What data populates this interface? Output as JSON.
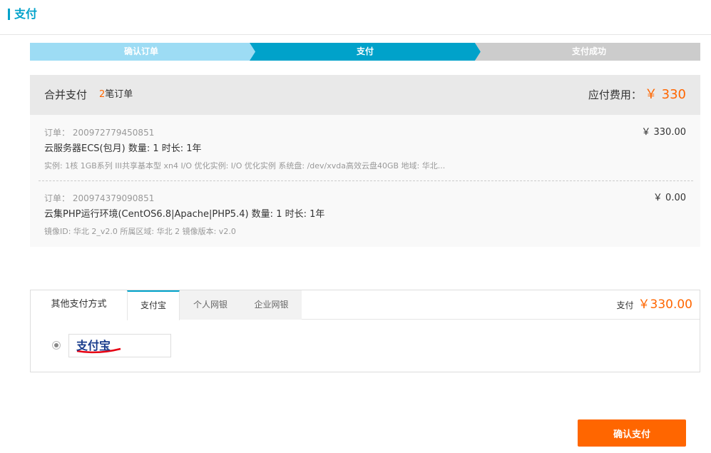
{
  "header": {
    "title": "支付"
  },
  "steps": [
    {
      "label": "确认订单",
      "state": "done"
    },
    {
      "label": "支付",
      "state": "active"
    },
    {
      "label": "支付成功",
      "state": "pending"
    }
  ],
  "colors": {
    "accent": "#00a2ca",
    "step_done": "#9ddcf4",
    "step_pending": "#cccccc",
    "price": "#ff6600"
  },
  "summary": {
    "merge_label": "合并支付",
    "order_count": "2",
    "order_count_suffix": "笔订单",
    "due_label": "应付费用：",
    "due_amount": "￥ 330"
  },
  "orders": [
    {
      "id_label": "订单： 200972779450851",
      "name": "云服务器ECS(包月) 数量: 1 时长: 1年",
      "detail": "实例: 1核 1GB系列 III共享基本型 xn4 I/O 优化实例: I/O 优化实例 系统盘: /dev/xvda高效云盘40GB 地域: 华北...",
      "price": "￥ 330.00"
    },
    {
      "id_label": "订单： 200974379090851",
      "name": "云集PHP运行环境(CentOS6.8|Apache|PHP5.4) 数量: 1 时长: 1年",
      "detail": "镜像ID: 华北 2_v2.0 所属区域: 华北 2 镜像版本: v2.0",
      "price": "￥ 0.00"
    }
  ],
  "payment": {
    "tabs": [
      "其他支付方式",
      "支付宝",
      "个人网银",
      "企业网银"
    ],
    "active_tab": "支付宝",
    "total_label": "支付",
    "total_amount": "￥330.00",
    "method_logo_text": "支付宝"
  },
  "confirm_button": "确认支付"
}
